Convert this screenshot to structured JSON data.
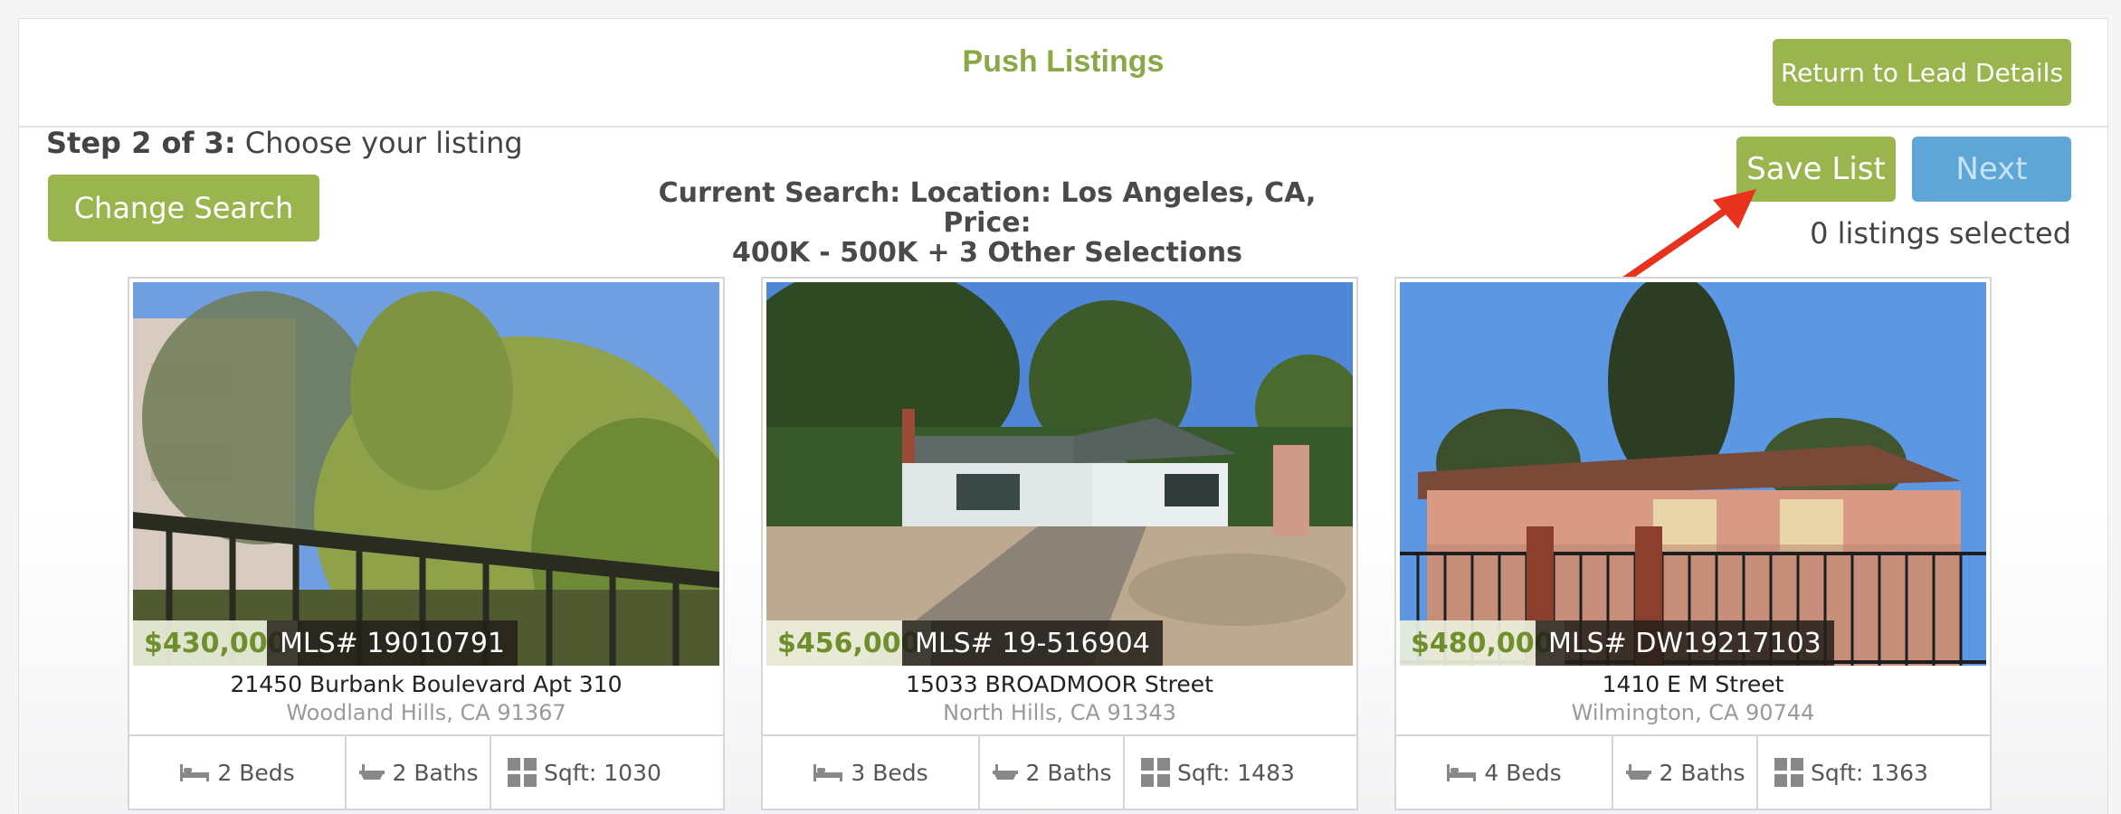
{
  "header": {
    "title": "Push Listings",
    "return_label": "Return to Lead Details"
  },
  "step": {
    "prefix": "Step 2 of 3:",
    "text": " Choose your listing"
  },
  "toolbar": {
    "change_search_label": "Change Search",
    "save_list_label": "Save List",
    "next_label": "Next",
    "selected_count": "0 listings selected"
  },
  "search": {
    "line1": "Current Search: Location: Los Angeles, CA, Price:",
    "line2": "400K - 500K + 3 Other Selections"
  },
  "colors": {
    "accent_green": "#9ab54e",
    "title_green": "#8aa846",
    "next_blue": "#5ea6d6",
    "arrow_red": "#e8321e"
  },
  "listings": [
    {
      "price": "$430,000",
      "mls": "MLS# 19010791",
      "address": "21450 Burbank Boulevard Apt 310",
      "city": "Woodland Hills, CA 91367",
      "beds": "2 Beds",
      "baths": "2 Baths",
      "sqft": "Sqft: 1030"
    },
    {
      "price": "$456,000",
      "mls": "MLS# 19-516904",
      "address": "15033 BROADMOOR Street",
      "city": "North Hills, CA 91343",
      "beds": "3 Beds",
      "baths": "2 Baths",
      "sqft": "Sqft: 1483"
    },
    {
      "price": "$480,000",
      "mls": "MLS# DW19217103",
      "address": "1410 E M Street",
      "city": "Wilmington, CA 90744",
      "beds": "4 Beds",
      "baths": "2 Baths",
      "sqft": "Sqft: 1363"
    }
  ]
}
